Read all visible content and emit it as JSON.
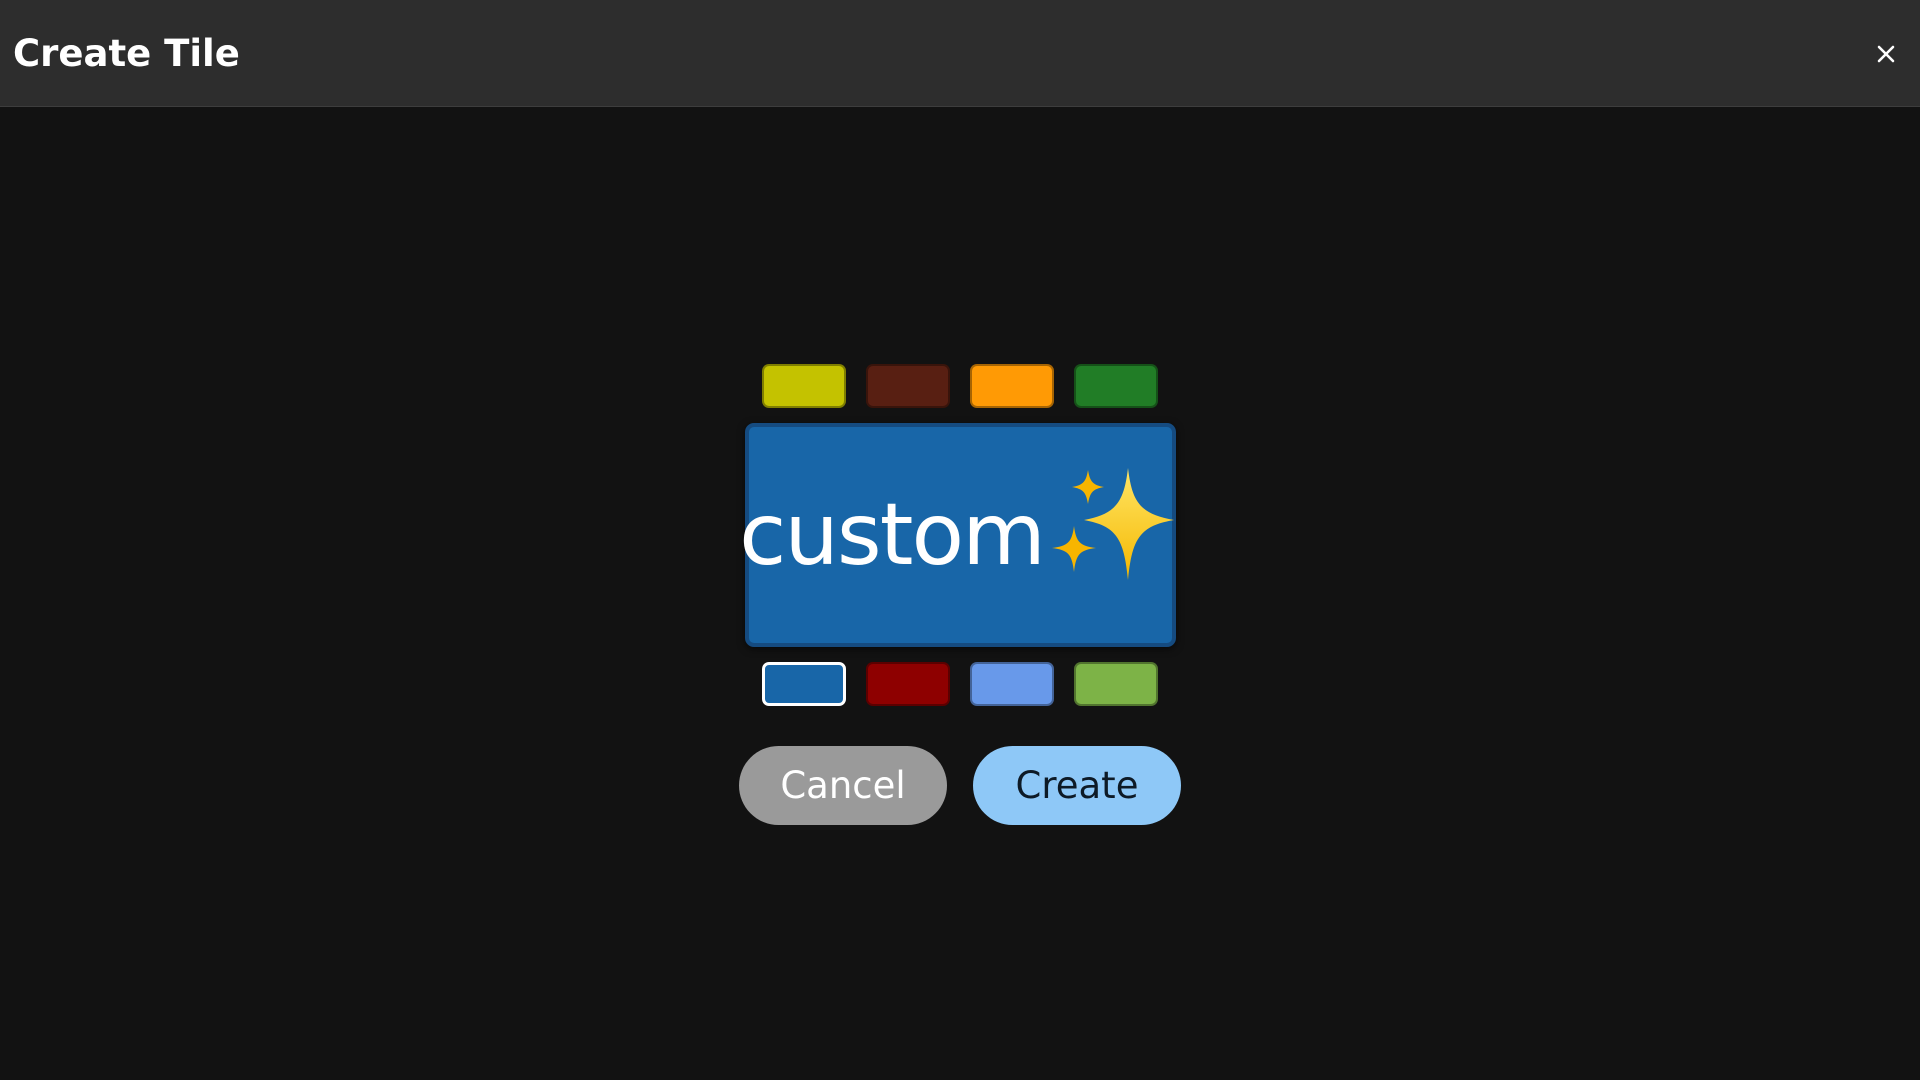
{
  "header": {
    "title": "Create Tile",
    "close_icon": "close-icon"
  },
  "tile": {
    "label": "custom",
    "emoji_icon": "sparkles-icon",
    "background_color": "#1866a8"
  },
  "swatches": {
    "top": [
      {
        "color": "#c4c200",
        "selected": false
      },
      {
        "color": "#581f12",
        "selected": false
      },
      {
        "color": "#ff9a05",
        "selected": false
      },
      {
        "color": "#217d26",
        "selected": false
      }
    ],
    "bottom": [
      {
        "color": "#1866a8",
        "selected": true
      },
      {
        "color": "#8e0000",
        "selected": false
      },
      {
        "color": "#6899ea",
        "selected": false
      },
      {
        "color": "#7db347",
        "selected": false
      }
    ]
  },
  "actions": {
    "cancel_label": "Cancel",
    "create_label": "Create"
  },
  "colors": {
    "cancel_bg": "#9a9a9a",
    "create_bg": "#8ec8f7",
    "header_bg": "#2d2d2d",
    "page_bg": "#121212"
  }
}
